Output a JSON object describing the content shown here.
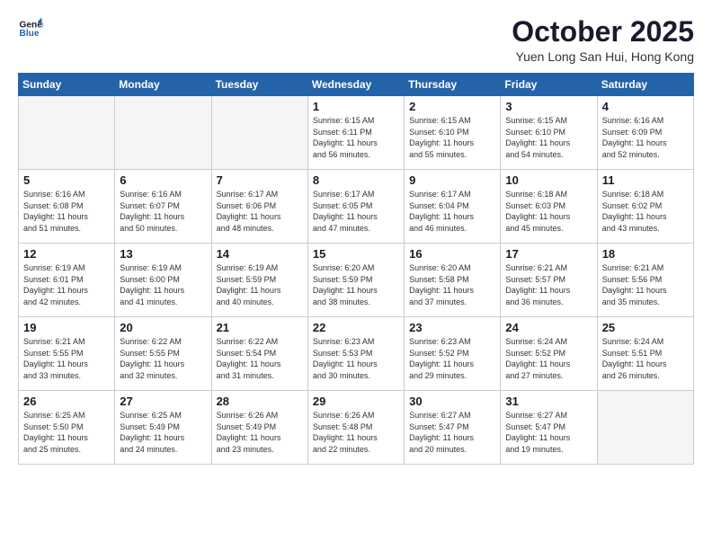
{
  "logo": {
    "line1": "General",
    "line2": "Blue"
  },
  "title": "October 2025",
  "subtitle": "Yuen Long San Hui, Hong Kong",
  "weekdays": [
    "Sunday",
    "Monday",
    "Tuesday",
    "Wednesday",
    "Thursday",
    "Friday",
    "Saturday"
  ],
  "weeks": [
    [
      {
        "day": "",
        "info": ""
      },
      {
        "day": "",
        "info": ""
      },
      {
        "day": "",
        "info": ""
      },
      {
        "day": "1",
        "info": "Sunrise: 6:15 AM\nSunset: 6:11 PM\nDaylight: 11 hours\nand 56 minutes."
      },
      {
        "day": "2",
        "info": "Sunrise: 6:15 AM\nSunset: 6:10 PM\nDaylight: 11 hours\nand 55 minutes."
      },
      {
        "day": "3",
        "info": "Sunrise: 6:15 AM\nSunset: 6:10 PM\nDaylight: 11 hours\nand 54 minutes."
      },
      {
        "day": "4",
        "info": "Sunrise: 6:16 AM\nSunset: 6:09 PM\nDaylight: 11 hours\nand 52 minutes."
      }
    ],
    [
      {
        "day": "5",
        "info": "Sunrise: 6:16 AM\nSunset: 6:08 PM\nDaylight: 11 hours\nand 51 minutes."
      },
      {
        "day": "6",
        "info": "Sunrise: 6:16 AM\nSunset: 6:07 PM\nDaylight: 11 hours\nand 50 minutes."
      },
      {
        "day": "7",
        "info": "Sunrise: 6:17 AM\nSunset: 6:06 PM\nDaylight: 11 hours\nand 48 minutes."
      },
      {
        "day": "8",
        "info": "Sunrise: 6:17 AM\nSunset: 6:05 PM\nDaylight: 11 hours\nand 47 minutes."
      },
      {
        "day": "9",
        "info": "Sunrise: 6:17 AM\nSunset: 6:04 PM\nDaylight: 11 hours\nand 46 minutes."
      },
      {
        "day": "10",
        "info": "Sunrise: 6:18 AM\nSunset: 6:03 PM\nDaylight: 11 hours\nand 45 minutes."
      },
      {
        "day": "11",
        "info": "Sunrise: 6:18 AM\nSunset: 6:02 PM\nDaylight: 11 hours\nand 43 minutes."
      }
    ],
    [
      {
        "day": "12",
        "info": "Sunrise: 6:19 AM\nSunset: 6:01 PM\nDaylight: 11 hours\nand 42 minutes."
      },
      {
        "day": "13",
        "info": "Sunrise: 6:19 AM\nSunset: 6:00 PM\nDaylight: 11 hours\nand 41 minutes."
      },
      {
        "day": "14",
        "info": "Sunrise: 6:19 AM\nSunset: 5:59 PM\nDaylight: 11 hours\nand 40 minutes."
      },
      {
        "day": "15",
        "info": "Sunrise: 6:20 AM\nSunset: 5:59 PM\nDaylight: 11 hours\nand 38 minutes."
      },
      {
        "day": "16",
        "info": "Sunrise: 6:20 AM\nSunset: 5:58 PM\nDaylight: 11 hours\nand 37 minutes."
      },
      {
        "day": "17",
        "info": "Sunrise: 6:21 AM\nSunset: 5:57 PM\nDaylight: 11 hours\nand 36 minutes."
      },
      {
        "day": "18",
        "info": "Sunrise: 6:21 AM\nSunset: 5:56 PM\nDaylight: 11 hours\nand 35 minutes."
      }
    ],
    [
      {
        "day": "19",
        "info": "Sunrise: 6:21 AM\nSunset: 5:55 PM\nDaylight: 11 hours\nand 33 minutes."
      },
      {
        "day": "20",
        "info": "Sunrise: 6:22 AM\nSunset: 5:55 PM\nDaylight: 11 hours\nand 32 minutes."
      },
      {
        "day": "21",
        "info": "Sunrise: 6:22 AM\nSunset: 5:54 PM\nDaylight: 11 hours\nand 31 minutes."
      },
      {
        "day": "22",
        "info": "Sunrise: 6:23 AM\nSunset: 5:53 PM\nDaylight: 11 hours\nand 30 minutes."
      },
      {
        "day": "23",
        "info": "Sunrise: 6:23 AM\nSunset: 5:52 PM\nDaylight: 11 hours\nand 29 minutes."
      },
      {
        "day": "24",
        "info": "Sunrise: 6:24 AM\nSunset: 5:52 PM\nDaylight: 11 hours\nand 27 minutes."
      },
      {
        "day": "25",
        "info": "Sunrise: 6:24 AM\nSunset: 5:51 PM\nDaylight: 11 hours\nand 26 minutes."
      }
    ],
    [
      {
        "day": "26",
        "info": "Sunrise: 6:25 AM\nSunset: 5:50 PM\nDaylight: 11 hours\nand 25 minutes."
      },
      {
        "day": "27",
        "info": "Sunrise: 6:25 AM\nSunset: 5:49 PM\nDaylight: 11 hours\nand 24 minutes."
      },
      {
        "day": "28",
        "info": "Sunrise: 6:26 AM\nSunset: 5:49 PM\nDaylight: 11 hours\nand 23 minutes."
      },
      {
        "day": "29",
        "info": "Sunrise: 6:26 AM\nSunset: 5:48 PM\nDaylight: 11 hours\nand 22 minutes."
      },
      {
        "day": "30",
        "info": "Sunrise: 6:27 AM\nSunset: 5:47 PM\nDaylight: 11 hours\nand 20 minutes."
      },
      {
        "day": "31",
        "info": "Sunrise: 6:27 AM\nSunset: 5:47 PM\nDaylight: 11 hours\nand 19 minutes."
      },
      {
        "day": "",
        "info": ""
      }
    ]
  ]
}
